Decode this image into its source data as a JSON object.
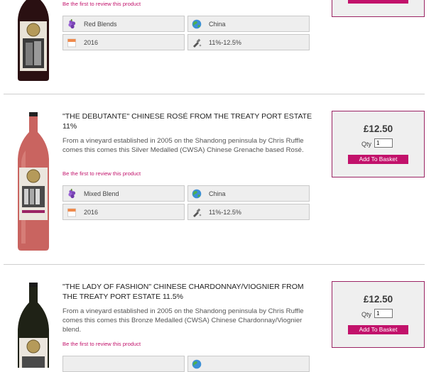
{
  "review_link_text": "Be the first to review this product",
  "add_to_basket_label": "Add To Basket",
  "qty_label": "Qty",
  "products": [
    {
      "title": "",
      "description": "",
      "attributes": {
        "style": "Red Blends",
        "country": "China",
        "vintage": "2016",
        "abv": "11%-12.5%"
      },
      "bottle_color": "#3a1418",
      "label_color": "#e9e3d8"
    },
    {
      "title": "\"THE DEBUTANTE\" CHINESE ROSÉ FROM THE TREATY PORT ESTATE 11%",
      "description": "From a vineyard established in 2005 on the Shandong peninsula by Chris Ruffle comes this comes this Silver Medalled (CWSA) Chinese Grenache based Rosé.",
      "price": "£12.50",
      "qty": "1",
      "attributes": {
        "style": "Mixed Blend",
        "country": "China",
        "vintage": "2016",
        "abv": "11%-12.5%"
      },
      "bottle_color": "#c9655f",
      "label_color": "#ece7df"
    },
    {
      "title": "\"THE LADY OF FASHION\" CHINESE CHARDONNAY/VIOGNIER FROM THE TREATY PORT ESTATE 11.5%",
      "description": "From a vineyard established in 2005 on the Shandong peninsula by Chris Ruffle comes this comes this Bronze Medalled (CWSA) Chinese Chardonnay/Viognier blend.",
      "price": "£12.50",
      "qty": "1",
      "bottle_color": "#1d2015",
      "label_color": "#ece7df"
    }
  ]
}
